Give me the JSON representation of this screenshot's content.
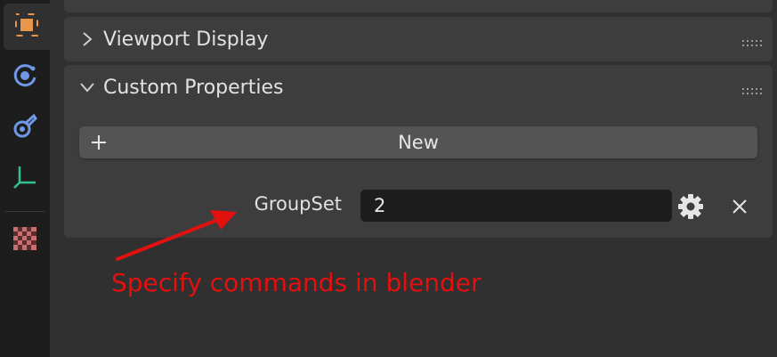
{
  "panels": {
    "viewport_display": {
      "title": "Viewport Display"
    },
    "custom_properties": {
      "title": "Custom Properties",
      "new_button_label": "New",
      "property": {
        "name": "GroupSet",
        "value": "2"
      }
    }
  },
  "annotation": {
    "text": "Specify commands in blender",
    "color": "#e31010"
  },
  "tabs": [
    {
      "icon": "object-icon",
      "active": true
    },
    {
      "icon": "physics-icon",
      "active": false
    },
    {
      "icon": "constraints-icon",
      "active": false
    },
    {
      "icon": "object-data-icon",
      "active": false
    },
    {
      "icon": "texture-icon",
      "active": false
    }
  ],
  "colors": {
    "accent_orange": "#e8964b",
    "physics_blue": "#6f98e6",
    "data_green": "#35c08f",
    "texture_red": "#c86e6e"
  }
}
